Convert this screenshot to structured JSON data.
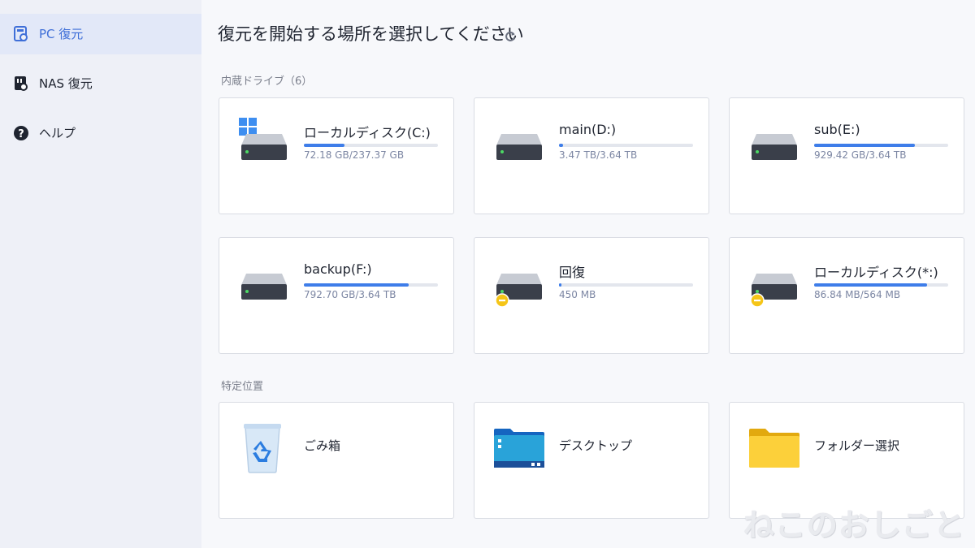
{
  "sidebar": {
    "items": [
      {
        "label": "PC 復元",
        "icon": "pc-recovery-icon",
        "active": true
      },
      {
        "label": "NAS 復元",
        "icon": "nas-recovery-icon",
        "active": false
      },
      {
        "label": "ヘルプ",
        "icon": "help-icon",
        "active": false
      }
    ]
  },
  "header": {
    "title": "復元を開始する場所を選択してください",
    "refresh_icon": "refresh-icon"
  },
  "internal": {
    "label": "内蔵ドライブ（6）",
    "drives": [
      {
        "name": "ローカルディスク(C:)",
        "size": "72.18 GB/237.37 GB",
        "used_fraction": 0.3,
        "windows": true,
        "warning": false
      },
      {
        "name": "main(D:)",
        "size": "3.47 TB/3.64 TB",
        "used_fraction": 0.03,
        "windows": false,
        "warning": false
      },
      {
        "name": "sub(E:)",
        "size": "929.42 GB/3.64 TB",
        "used_fraction": 0.75,
        "windows": false,
        "warning": false
      },
      {
        "name": "backup(F:)",
        "size": "792.70 GB/3.64 TB",
        "used_fraction": 0.78,
        "windows": false,
        "warning": false
      },
      {
        "name": "回復",
        "size": "450 MB",
        "used_fraction": 0.01,
        "windows": false,
        "warning": true
      },
      {
        "name": "ローカルディスク(*:)",
        "size": "86.84 MB/564 MB",
        "used_fraction": 0.84,
        "windows": false,
        "warning": true
      }
    ]
  },
  "specific": {
    "label": "特定位置",
    "items": [
      {
        "name": "ごみ箱",
        "icon": "recycle-bin-icon"
      },
      {
        "name": "デスクトップ",
        "icon": "desktop-folder-icon"
      },
      {
        "name": "フォルダー選択",
        "icon": "folder-icon"
      }
    ]
  },
  "watermark": "ねこのおしごと",
  "colors": {
    "accent": "#3e7de9",
    "sidebar_bg": "#eef0f7",
    "active_bg": "#e2e8f8",
    "warning": "#f5c518"
  }
}
